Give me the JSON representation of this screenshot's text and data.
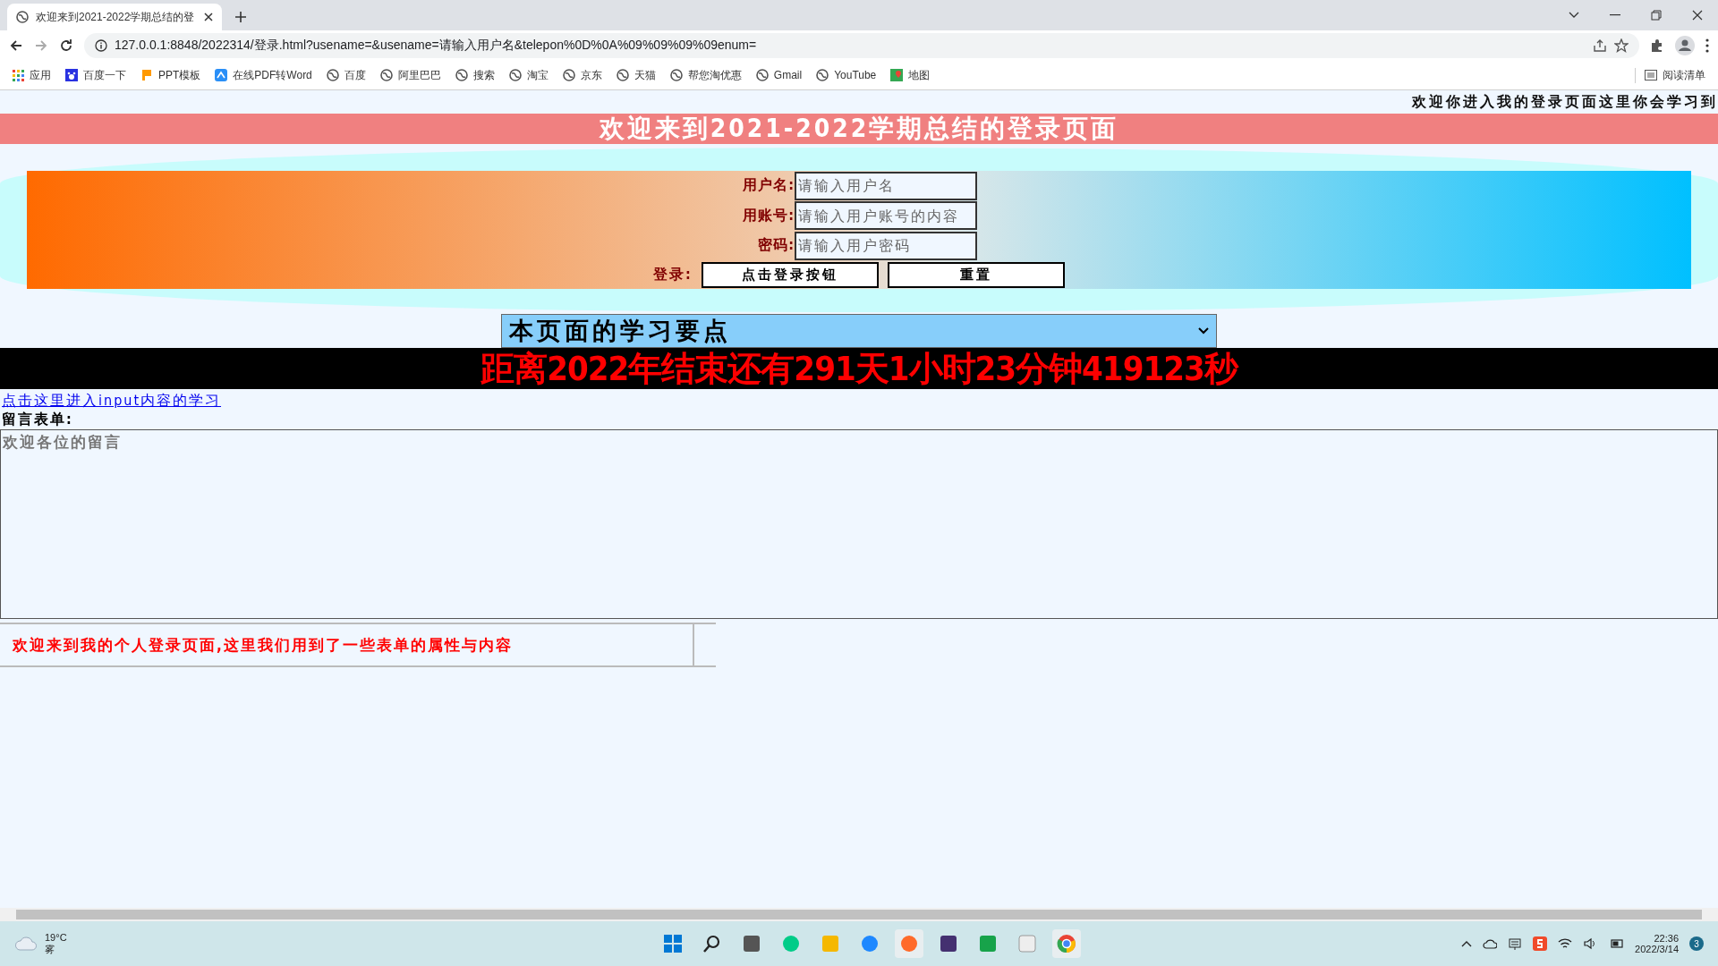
{
  "browser": {
    "tab_title": "欢迎来到2021-2022学期总结的登",
    "url": "127.0.0.1:8848/2022314/登录.html?usename=&usename=请输入用户名&telepon%0D%0A%09%09%09%09enum=",
    "bookmarks": [
      {
        "kind": "apps",
        "label": "应用"
      },
      {
        "kind": "paw",
        "label": "百度一下"
      },
      {
        "kind": "ppt",
        "label": "PPT模板"
      },
      {
        "kind": "pdf",
        "label": "在线PDF转Word"
      },
      {
        "kind": "globe",
        "label": "百度"
      },
      {
        "kind": "globe",
        "label": "阿里巴巴"
      },
      {
        "kind": "globe",
        "label": "搜索"
      },
      {
        "kind": "globe",
        "label": "淘宝"
      },
      {
        "kind": "globe",
        "label": "京东"
      },
      {
        "kind": "globe",
        "label": "天猫"
      },
      {
        "kind": "globe",
        "label": "帮您淘优惠"
      },
      {
        "kind": "globe",
        "label": "Gmail"
      },
      {
        "kind": "globe",
        "label": "YouTube"
      },
      {
        "kind": "map",
        "label": "地图"
      }
    ],
    "reading_list": "阅读清单"
  },
  "page": {
    "marquee": "欢迎你进入我的登录页面这里你会学习到",
    "header_title": "欢迎来到2021-2022学期总结的登录页面",
    "login": {
      "fields": [
        {
          "label": "用户名:",
          "placeholder": "请输入用户名"
        },
        {
          "label": "用账号:",
          "placeholder": "请输入用户账号的内容"
        },
        {
          "label": "密码:",
          "placeholder": "请输入用户密码"
        }
      ],
      "action_label": "登录:",
      "buttons": [
        "点击登录按钮",
        "重置"
      ]
    },
    "select": {
      "value": "本页面的学习要点"
    },
    "countdown": "距离2022年结束还有291天1小时23分钟419123秒",
    "link": "点击这里进入input内容的学习",
    "form_label": "留言表单:",
    "message": {
      "placeholder": "欢迎各位的留言"
    },
    "footer_note": "欢迎来到我的个人登录页面,这里我们用到了一些表单的属性与内容"
  },
  "taskbar": {
    "temperature": "19°C",
    "condition": "雾",
    "time": "22:36",
    "date": "2022/3/14",
    "notifications": "3"
  }
}
